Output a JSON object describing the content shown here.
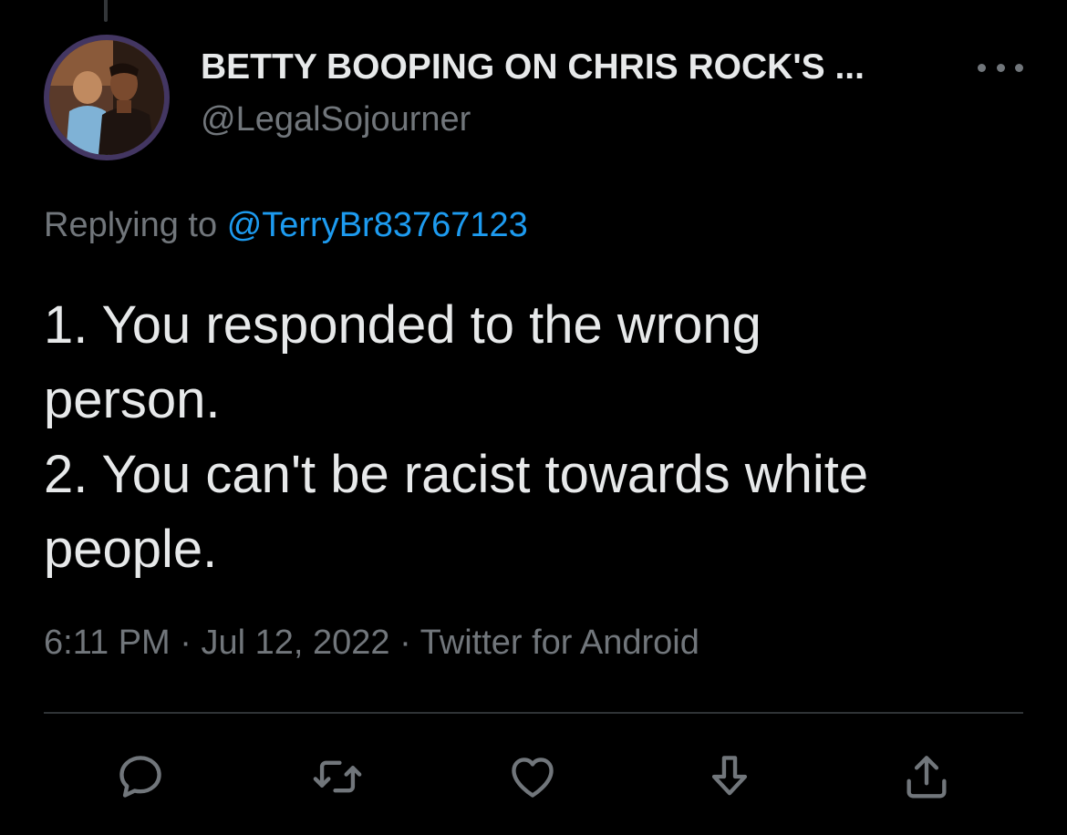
{
  "tweet": {
    "author": {
      "display_name": "BETTY BOOPING ON CHRIS ROCK'S ...",
      "handle": "@LegalSojourner"
    },
    "replying": {
      "prefix": "Replying to",
      "mention": "@TerryBr83767123"
    },
    "text_lines": [
      "1. You responded to the wrong",
      "person.",
      "2. You can't be racist towards white",
      "people."
    ],
    "meta": {
      "time": "6:11 PM",
      "separator1": " · ",
      "date": "Jul 12, 2022",
      "separator2": " · ",
      "source": "Twitter for Android"
    }
  },
  "icons": {
    "more": "more-dots-icon",
    "reply": "reply-bubble-icon",
    "retweet": "retweet-icon",
    "like": "heart-icon",
    "bookmark": "download-arrow-icon",
    "share": "share-upload-icon"
  },
  "colors": {
    "background": "#000000",
    "text_primary": "#e7e9ea",
    "text_secondary": "#71767b",
    "accent": "#1d9bf0",
    "divider": "#2f3336"
  }
}
